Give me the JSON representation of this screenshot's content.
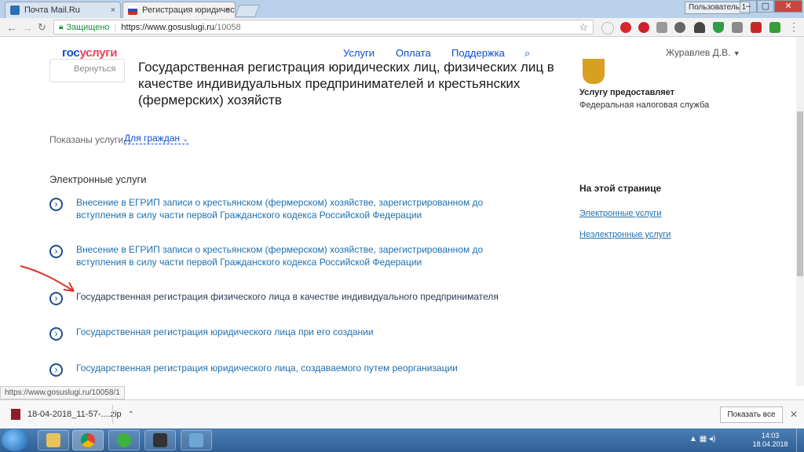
{
  "browser": {
    "tabs": [
      {
        "title": "Почта Mail.Ru",
        "close": "×"
      },
      {
        "title": "Регистрация юридическ",
        "close": "×"
      }
    ],
    "user_button": "Пользователь 1",
    "window_controls": {
      "minimize": "–",
      "maximize": "▢",
      "close": "✕"
    },
    "secure_label": "Защищено",
    "url_host": "https://www.gosuslugi.ru",
    "url_path": "/10058",
    "status_url": "https://www.gosuslugi.ru/10058/1"
  },
  "site": {
    "logo_part1": "гос",
    "logo_part2": "услуги",
    "nav": [
      "Услуги",
      "Оплата",
      "Поддержка"
    ],
    "user_name": "Журавлев Д.В.",
    "back_label": "Вернуться",
    "page_title": "Государственная регистрация юридических лиц, физических лиц в качестве индивидуальных предпринимателей и крестьянских (фермерских) хозяйств",
    "provider_label": "Услугу предоставляет",
    "provider_name": "Федеральная налоговая служба",
    "shown_label": "Показаны услуги",
    "filter_value": "Для граждан",
    "section_title": "Электронные услуги",
    "services": [
      {
        "text": "Внесение в ЕГРИП записи о крестьянском (фермерском) хозяйстве, зарегистрированном до вступления в силу части первой Гражданского кодекса Российской Федерации"
      },
      {
        "text": "Внесение в ЕГРИП записи о крестьянском (фермерском) хозяйстве, зарегистрированном до вступления в силу части первой Гражданского кодекса Российской Федерации"
      },
      {
        "text": "Государственная регистрация физического лица в качестве индивидуального предпринимателя"
      },
      {
        "text": "Государственная регистрация юридического лица при его создании"
      },
      {
        "text": "Государственная регистрация юридического лица, создаваемого путем реорганизации"
      }
    ],
    "on_page_title": "На этой странице",
    "on_page_links": [
      "Электронные услуги",
      "Неэлектронные услуги"
    ]
  },
  "downloads": {
    "file": "18-04-2018_11-57-....zip",
    "show_all": "Показать все"
  },
  "taskbar": {
    "time": "14:03",
    "date": "18.04.2018"
  },
  "colors": {
    "brand_blue": "#0d4cd3",
    "brand_red": "#ee3f58",
    "link": "#1d6fae",
    "annotation_arrow": "#d9322a"
  }
}
